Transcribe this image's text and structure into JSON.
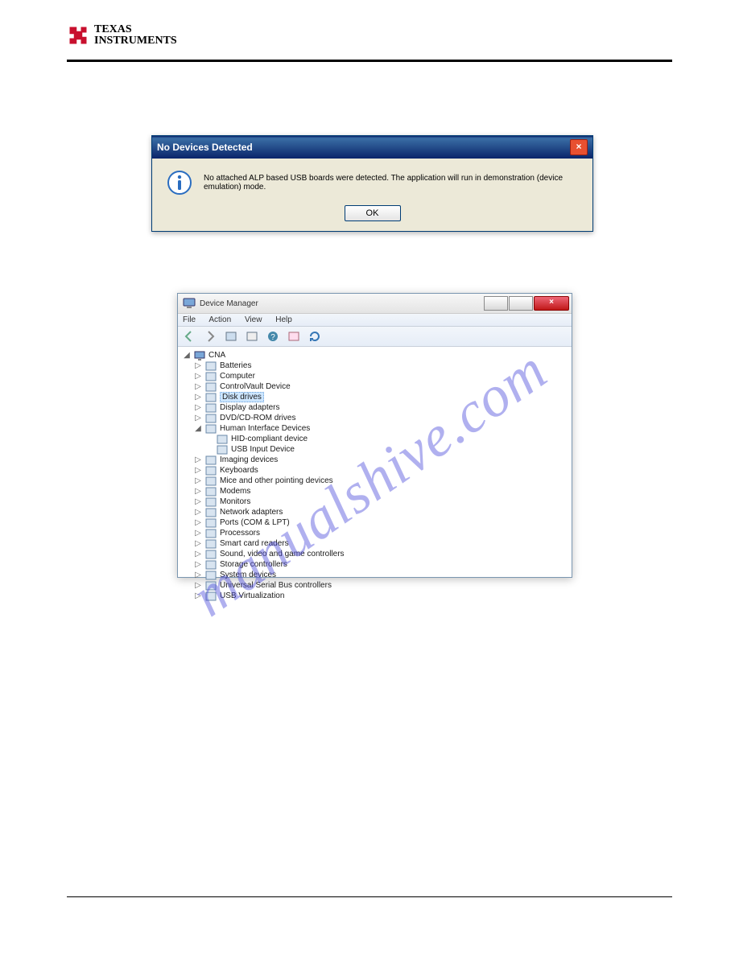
{
  "logo": {
    "line1": "TEXAS",
    "line2": "INSTRUMENTS"
  },
  "watermark": "manualshive.com",
  "dialog": {
    "title": "No Devices Detected",
    "message": "No attached ALP based USB boards were detected. The application will run in demonstration (device emulation) mode.",
    "ok": "OK"
  },
  "dm": {
    "title": "Device Manager",
    "menu": {
      "file": "File",
      "action": "Action",
      "view": "View",
      "help": "Help"
    },
    "root": "CNA",
    "items": [
      {
        "label": "Batteries"
      },
      {
        "label": "Computer"
      },
      {
        "label": "ControlVault Device"
      },
      {
        "label": "Disk drives",
        "selected": true
      },
      {
        "label": "Display adapters"
      },
      {
        "label": "DVD/CD-ROM drives"
      },
      {
        "label": "Human Interface Devices",
        "expanded": true,
        "children": [
          {
            "label": "HID-compliant device"
          },
          {
            "label": "USB Input Device"
          }
        ]
      },
      {
        "label": "Imaging devices"
      },
      {
        "label": "Keyboards"
      },
      {
        "label": "Mice and other pointing devices"
      },
      {
        "label": "Modems"
      },
      {
        "label": "Monitors"
      },
      {
        "label": "Network adapters"
      },
      {
        "label": "Ports (COM & LPT)"
      },
      {
        "label": "Processors"
      },
      {
        "label": "Smart card readers"
      },
      {
        "label": "Sound, video and game controllers"
      },
      {
        "label": "Storage controllers"
      },
      {
        "label": "System devices"
      },
      {
        "label": "Universal Serial Bus controllers"
      },
      {
        "label": "USB Virtualization"
      }
    ]
  }
}
